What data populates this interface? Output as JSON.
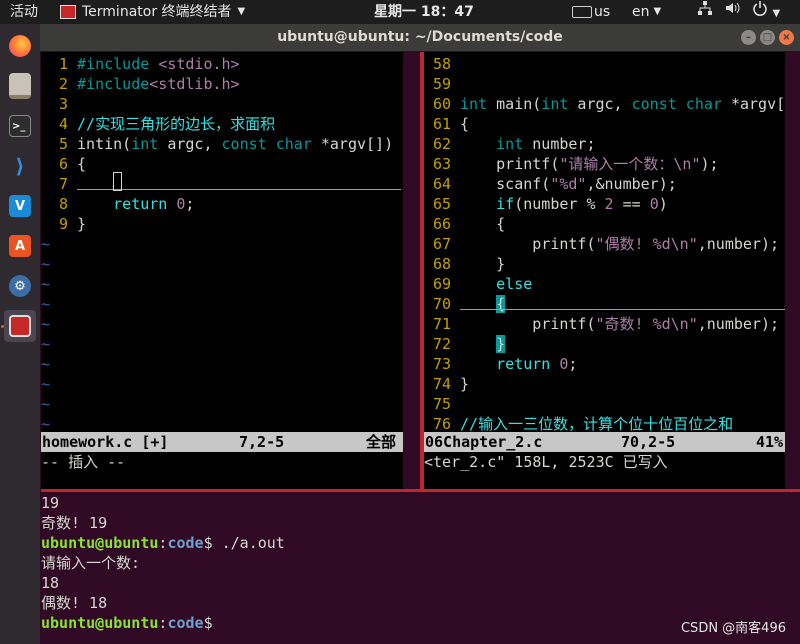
{
  "topbar": {
    "activities": "活动",
    "app_name": "Terminator 终端终结者",
    "clock": "星期一 18：47",
    "keyboard": "us",
    "language": "en"
  },
  "dock": {
    "items": [
      "firefox-icon",
      "files-icon",
      "terminal-icon",
      "vscode-icon",
      "vmware-icon",
      "software-center-icon",
      "network-tool-icon",
      "terminator-icon"
    ]
  },
  "window": {
    "title": "ubuntu@ubuntu: ~/Documents/code"
  },
  "left_pane": {
    "lines": [
      {
        "n": "1",
        "segs": [
          [
            "pp",
            "#include "
          ],
          [
            "str",
            "<stdio.h>"
          ]
        ]
      },
      {
        "n": "2",
        "segs": [
          [
            "pp",
            "#include"
          ],
          [
            "str",
            "<stdlib.h>"
          ]
        ]
      },
      {
        "n": "3",
        "segs": []
      },
      {
        "n": "4",
        "segs": [
          [
            "cm",
            "//实现三角形的边长，求面积"
          ]
        ]
      },
      {
        "n": "5",
        "segs": [
          [
            "tx",
            "intin("
          ],
          [
            "kw2",
            "int"
          ],
          [
            "tx",
            " argc, "
          ],
          [
            "kw2",
            "const char"
          ],
          [
            "tx",
            " *argv[])"
          ]
        ]
      },
      {
        "n": "6",
        "segs": [
          [
            "tx",
            "{"
          ]
        ]
      },
      {
        "n": "7",
        "segs": []
      },
      {
        "n": "8",
        "segs": [
          [
            "tx",
            "    "
          ],
          [
            "kw",
            "return"
          ],
          [
            "tx",
            " "
          ],
          [
            "num",
            "0"
          ],
          [
            "tx",
            ";"
          ]
        ]
      },
      {
        "n": "9",
        "segs": [
          [
            "tx",
            "}"
          ]
        ]
      }
    ],
    "tildes": 10,
    "status_file": "homework.c [+]",
    "status_pos": "7,2-5",
    "status_scroll": "全部",
    "cmdline": "-- 插入 --"
  },
  "right_pane": {
    "lines": [
      {
        "n": "58",
        "segs": []
      },
      {
        "n": "59",
        "segs": []
      },
      {
        "n": "60",
        "segs": [
          [
            "kw2",
            "int"
          ],
          [
            "tx",
            " main("
          ],
          [
            "kw2",
            "int"
          ],
          [
            "tx",
            " argc, "
          ],
          [
            "kw2",
            "const char"
          ],
          [
            "tx",
            " *argv["
          ]
        ]
      },
      {
        "n": "61",
        "segs": [
          [
            "tx",
            "{"
          ]
        ]
      },
      {
        "n": "62",
        "segs": [
          [
            "tx",
            "    "
          ],
          [
            "kw2",
            "int"
          ],
          [
            "tx",
            " number;"
          ]
        ]
      },
      {
        "n": "63",
        "segs": [
          [
            "tx",
            "    printf("
          ],
          [
            "str",
            "\"请输入一个数：\\n\""
          ],
          [
            "tx",
            ");"
          ]
        ]
      },
      {
        "n": "64",
        "segs": [
          [
            "tx",
            "    scanf("
          ],
          [
            "str",
            "\"%d\""
          ],
          [
            "tx",
            ",&number);"
          ]
        ]
      },
      {
        "n": "65",
        "segs": [
          [
            "tx",
            "    "
          ],
          [
            "kw",
            "if"
          ],
          [
            "tx",
            "(number % "
          ],
          [
            "num",
            "2"
          ],
          [
            "tx",
            " == "
          ],
          [
            "num",
            "0"
          ],
          [
            "tx",
            ")"
          ]
        ]
      },
      {
        "n": "66",
        "segs": [
          [
            "tx",
            "    {"
          ]
        ]
      },
      {
        "n": "67",
        "segs": [
          [
            "tx",
            "        printf("
          ],
          [
            "str",
            "\"偶数! %d\\n\""
          ],
          [
            "tx",
            ",number);"
          ]
        ]
      },
      {
        "n": "68",
        "segs": [
          [
            "tx",
            "    }"
          ]
        ]
      },
      {
        "n": "69",
        "segs": [
          [
            "tx",
            "    "
          ],
          [
            "kw",
            "else"
          ]
        ]
      },
      {
        "n": "70",
        "segs": [
          [
            "tx",
            "    "
          ],
          [
            "cur",
            "{"
          ]
        ]
      },
      {
        "n": "71",
        "segs": [
          [
            "tx",
            "        printf("
          ],
          [
            "str",
            "\"奇数! %d\\n\""
          ],
          [
            "tx",
            ",number);"
          ]
        ]
      },
      {
        "n": "72",
        "segs": [
          [
            "tx",
            "    "
          ],
          [
            "cur",
            "}"
          ]
        ]
      },
      {
        "n": "73",
        "segs": [
          [
            "tx",
            "    "
          ],
          [
            "kw",
            "return"
          ],
          [
            "tx",
            " "
          ],
          [
            "num",
            "0"
          ],
          [
            "tx",
            ";"
          ]
        ]
      },
      {
        "n": "74",
        "segs": [
          [
            "tx",
            "}"
          ]
        ]
      },
      {
        "n": "75",
        "segs": []
      },
      {
        "n": "76",
        "segs": [
          [
            "cm",
            "//输入一三位数，计算个位十位百位之和"
          ]
        ]
      }
    ],
    "status_file": "06Chapter_2.c",
    "status_pos": "70,2-5",
    "status_scroll": "41%",
    "cmdline": "<ter_2.c\" 158L, 2523C 已写入"
  },
  "bottom_pane": {
    "lines": [
      [
        [
          "tx",
          "19"
        ]
      ],
      [
        [
          "tx",
          "奇数! 19"
        ]
      ],
      [
        [
          "green",
          "ubuntu@ubuntu"
        ],
        [
          "tx",
          ":"
        ],
        [
          "blue",
          "code"
        ],
        [
          "tx",
          "$ ./a.out"
        ]
      ],
      [
        [
          "tx",
          "请输入一个数:"
        ]
      ],
      [
        [
          "tx",
          "18"
        ]
      ],
      [
        [
          "tx",
          "偶数! 18"
        ]
      ],
      [
        [
          "green",
          "ubuntu@ubuntu"
        ],
        [
          "tx",
          ":"
        ],
        [
          "blue",
          "code"
        ],
        [
          "tx",
          "$"
        ]
      ]
    ]
  },
  "watermark": "CSDN @南客496"
}
